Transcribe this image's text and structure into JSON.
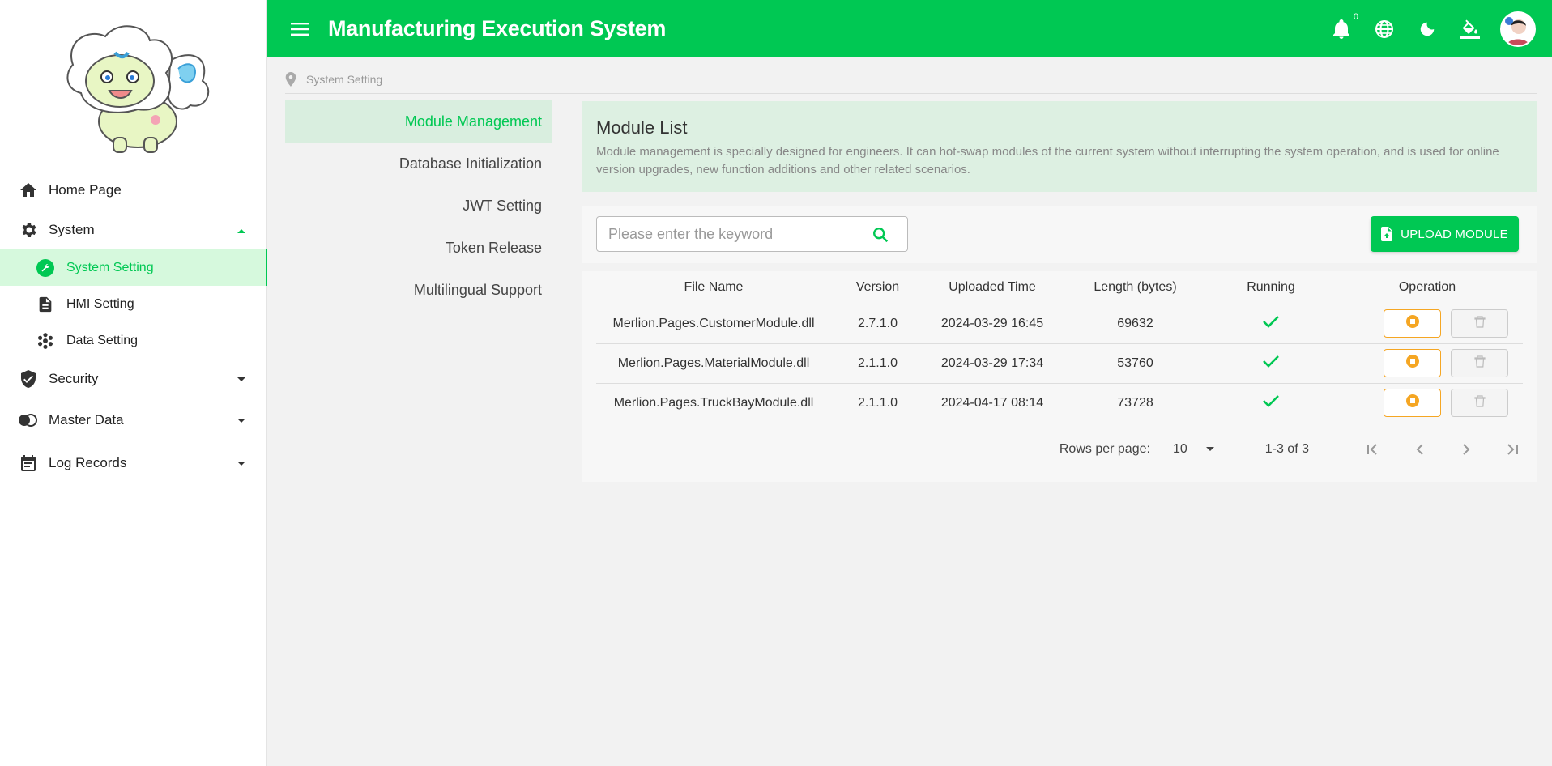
{
  "app": {
    "title": "Manufacturing Execution System"
  },
  "colors": {
    "primary": "#00c853",
    "warning": "#f5a623",
    "active_bg": "#d6f9dd",
    "info_bg": "#ddf0e2"
  },
  "header": {
    "notification_count": "0"
  },
  "sidebar": {
    "items": [
      {
        "label": "Home Page",
        "icon": "home-icon"
      },
      {
        "label": "System",
        "icon": "gear-icon",
        "expanded": true
      },
      {
        "label": "System Setting",
        "icon": "wrench-icon",
        "active": true
      },
      {
        "label": "HMI Setting",
        "icon": "document-icon"
      },
      {
        "label": "Data Setting",
        "icon": "hexagons-icon"
      },
      {
        "label": "Security",
        "icon": "shield-check-icon"
      },
      {
        "label": "Master Data",
        "icon": "toggle-icon"
      },
      {
        "label": "Log Records",
        "icon": "calendar-icon"
      }
    ]
  },
  "breadcrumb": {
    "label": "System Setting"
  },
  "subnav": {
    "items": [
      {
        "label": "Module Management",
        "active": true
      },
      {
        "label": "Database Initialization"
      },
      {
        "label": "JWT Setting"
      },
      {
        "label": "Token Release"
      },
      {
        "label": "Multilingual Support"
      }
    ]
  },
  "info": {
    "title": "Module List",
    "description": "Module management is specially designed for engineers. It can hot-swap modules of the current system without interrupting the system operation, and is used for online version upgrades, new function additions and other related scenarios."
  },
  "search": {
    "placeholder": "Please enter the keyword",
    "value": ""
  },
  "upload": {
    "label": "UPLOAD MODULE"
  },
  "table": {
    "columns": [
      "File Name",
      "Version",
      "Uploaded Time",
      "Length (bytes)",
      "Running",
      "Operation"
    ],
    "rows": [
      {
        "file": "Merlion.Pages.CustomerModule.dll",
        "version": "2.7.1.0",
        "time": "2024-03-29 16:45",
        "length": "69632",
        "running": true
      },
      {
        "file": "Merlion.Pages.MaterialModule.dll",
        "version": "2.1.1.0",
        "time": "2024-03-29 17:34",
        "length": "53760",
        "running": true
      },
      {
        "file": "Merlion.Pages.TruckBayModule.dll",
        "version": "2.1.1.0",
        "time": "2024-04-17 08:14",
        "length": "73728",
        "running": true
      }
    ]
  },
  "pager": {
    "rows_label": "Rows per page:",
    "rows_value": "10",
    "range": "1-3 of 3"
  }
}
